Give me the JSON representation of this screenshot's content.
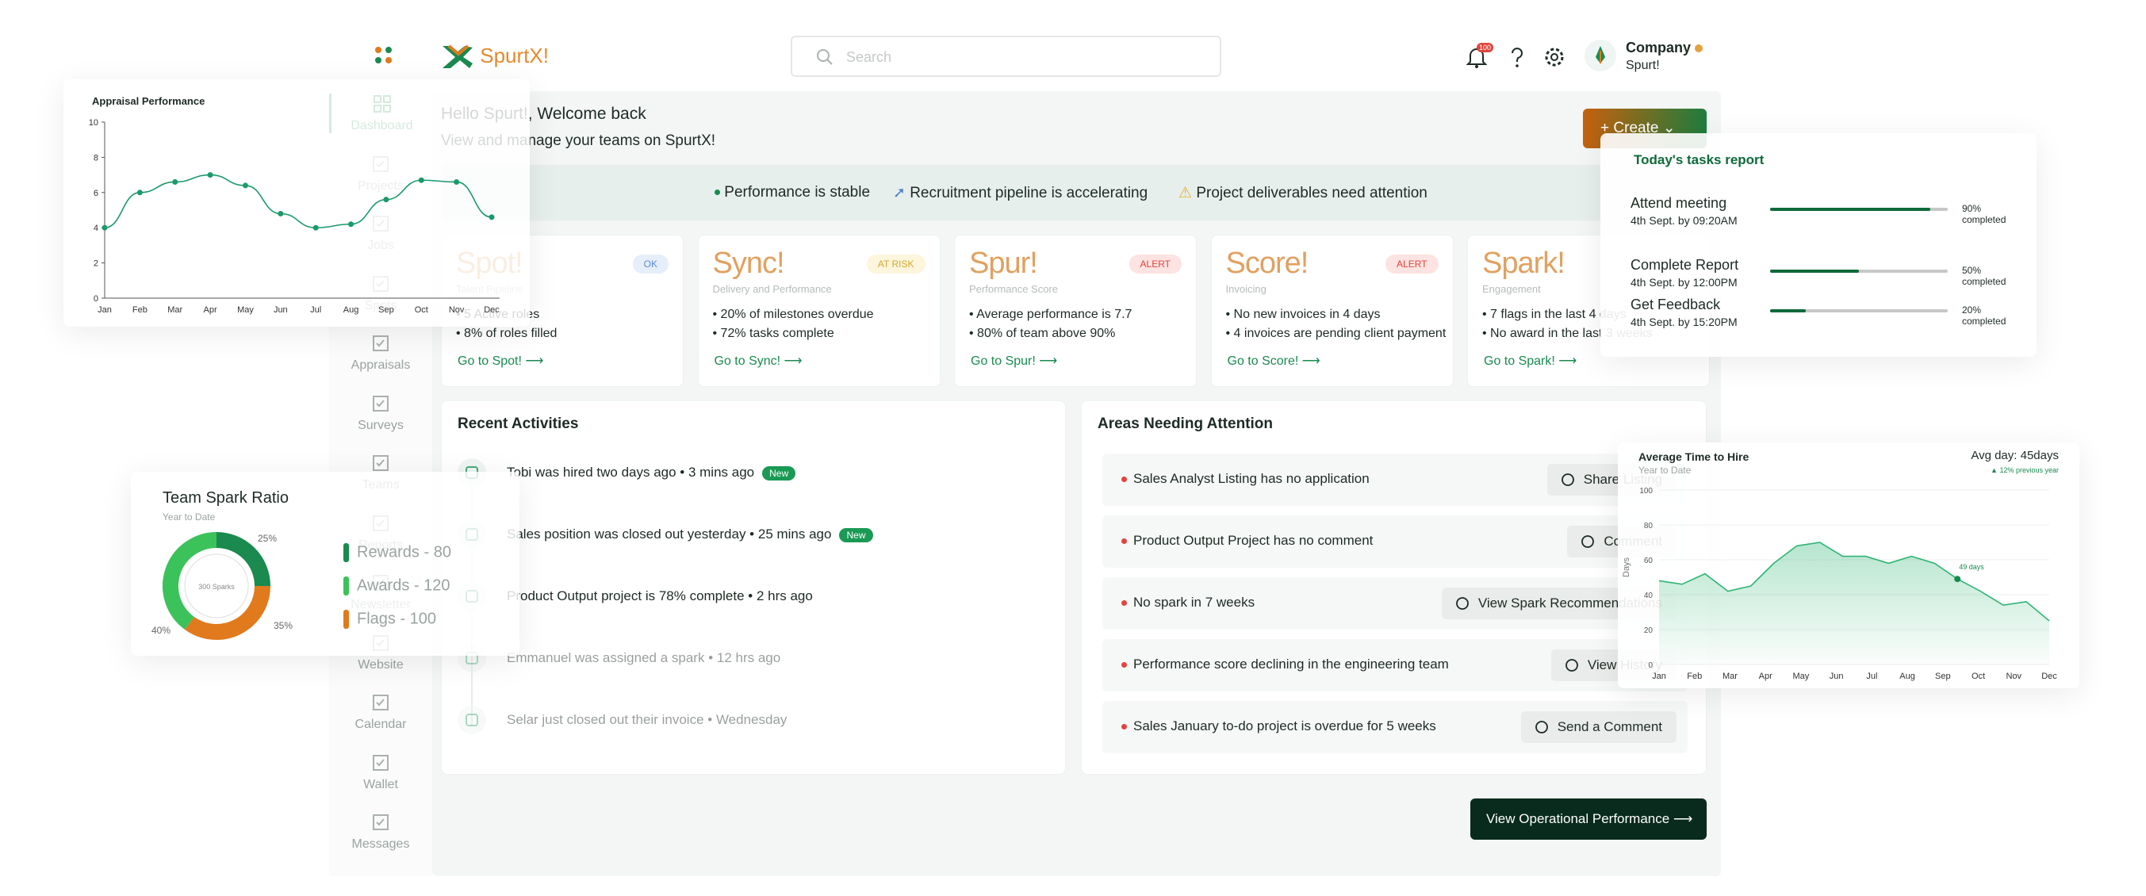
{
  "brand": {
    "logo_text": "SpurtX!"
  },
  "search": {
    "placeholder": "Search"
  },
  "header": {
    "notification_count": "100",
    "company_name": "Company",
    "company_sub": "Spurt!"
  },
  "sidebar": {
    "items": [
      {
        "label": "Dashboard",
        "icon": "dashboard-icon",
        "active": true
      },
      {
        "label": "Projects",
        "icon": "projects-icon"
      },
      {
        "label": "Jobs",
        "icon": "jobs-icon"
      },
      {
        "label": "Spots",
        "icon": "spots-icon"
      },
      {
        "label": "Appraisals",
        "icon": "appraisals-icon"
      },
      {
        "label": "Surveys",
        "icon": "surveys-icon"
      },
      {
        "label": "Teams",
        "icon": "teams-icon"
      },
      {
        "label": "Reports",
        "icon": "reports-icon"
      },
      {
        "label": "Newsletter",
        "icon": "newsletter-icon"
      },
      {
        "label": "Website",
        "icon": "website-icon"
      },
      {
        "label": "Calendar",
        "icon": "calendar-icon"
      },
      {
        "label": "Wallet",
        "icon": "wallet-icon"
      },
      {
        "label": "Messages",
        "icon": "messages-icon"
      }
    ]
  },
  "welcome": {
    "title": "Hello Spurt!, Welcome back",
    "subtitle": "View and manage your teams on SpurtX!",
    "create_label": "Create"
  },
  "banner": {
    "items": [
      "Performance is stable",
      "Recruitment pipeline is accelerating",
      "Project deliverables need attention"
    ]
  },
  "modules": [
    {
      "name": "Spot!",
      "sub": "Talent Pipeline",
      "badge": "OK",
      "badge_color": "#e6eef9",
      "badge_text": "#5b8bd6",
      "points": [
        "5 Active roles",
        "8% of roles filled"
      ],
      "link": "Go to Spot!"
    },
    {
      "name": "Sync!",
      "sub": "Delivery and Performance",
      "badge": "AT RISK",
      "badge_color": "#fdf6dc",
      "badge_text": "#d4a72c",
      "points": [
        "20% of milestones overdue",
        "72% tasks complete"
      ],
      "link": "Go to Sync!"
    },
    {
      "name": "Spur!",
      "sub": "Performance Score",
      "badge": "ALERT",
      "badge_color": "#fde3e1",
      "badge_text": "#e0453c",
      "points": [
        "Average performance is 7.7",
        "80% of team above 90%"
      ],
      "link": "Go to Spur!"
    },
    {
      "name": "Score!",
      "sub": "Invoicing",
      "badge": "ALERT",
      "badge_color": "#fde3e1",
      "badge_text": "#e0453c",
      "points": [
        "No new invoices in 4 days",
        "4 invoices are pending client payment"
      ],
      "link": "Go to Score!"
    },
    {
      "name": "Spark!",
      "sub": "Engagement",
      "badge": "",
      "badge_color": "",
      "badge_text": "",
      "points": [
        "7 flags in the last 4 days",
        "No award in the last 3 weeks"
      ],
      "link": "Go to Spark!"
    }
  ],
  "activities": {
    "title": "Recent Activities",
    "items": [
      {
        "text": "Tobi was hired two days ago",
        "time": "3 mins ago",
        "new": "New"
      },
      {
        "text": "Sales position was closed out yesterday",
        "time": "25 mins ago",
        "new": "New"
      },
      {
        "text": "Product Output project is 78% complete",
        "time": "2 hrs ago",
        "new": ""
      },
      {
        "text": "Emmanuel was assigned a spark",
        "time": "12 hrs ago",
        "new": ""
      },
      {
        "text": "Selar just closed out their invoice",
        "time": "Wednesday",
        "new": ""
      }
    ]
  },
  "attention": {
    "title": "Areas Needing Attention",
    "items": [
      {
        "text": "Sales Analyst Listing has no application",
        "action": "Share Listing",
        "icon": "share-icon"
      },
      {
        "text": "Product Output Project has no comment",
        "action": "Comment",
        "icon": "comment-icon"
      },
      {
        "text": "No spark in 7 weeks",
        "action": "View Spark Recommendations",
        "icon": "eye-icon"
      },
      {
        "text": "Performance score declining in the engineering team",
        "action": "View History",
        "icon": "history-icon"
      },
      {
        "text": "Sales January to-do project is overdue for 5 weeks",
        "action": "Send a Comment",
        "icon": "send-icon"
      }
    ]
  },
  "view_operational": "View Operational Performance",
  "tasks_report": {
    "title": "Today's tasks report",
    "items": [
      {
        "name": "Attend meeting",
        "date": "4th Sept. by 09:20AM",
        "progress": 0.9,
        "label": "90% completed"
      },
      {
        "name": "Complete Report",
        "date": "4th Sept. by 12:00PM",
        "progress": 0.5,
        "label": "50% completed"
      },
      {
        "name": "Get Feedback",
        "date": "4th Sept. by 15:20PM",
        "progress": 0.2,
        "label": "20% completed"
      }
    ]
  },
  "spark_ratio": {
    "title": "Team Spark Ratio",
    "subtitle": "Year to Date",
    "center": "300 Sparks",
    "legend": [
      "Rewards - 80",
      "Awards - 120",
      "Flags - 100"
    ],
    "legend_colors": [
      "#1a8a4f",
      "#3cc25a",
      "#e07a1c"
    ]
  },
  "chart_data": [
    {
      "type": "line",
      "title": "Appraisal Performance",
      "categories": [
        "Jan",
        "Feb",
        "Mar",
        "Apr",
        "May",
        "Jun",
        "Jul",
        "Aug",
        "Sep",
        "Oct",
        "Nov",
        "Dec"
      ],
      "values": [
        4,
        6,
        6.6,
        7,
        6.4,
        4.8,
        4,
        4.2,
        5.6,
        6.7,
        6.6,
        4.6
      ],
      "ylim": [
        0,
        10
      ],
      "yticks": [
        "0",
        "2",
        "4",
        "6",
        "8",
        "10"
      ]
    },
    {
      "type": "pie",
      "title": "Team Spark Ratio",
      "slices": [
        {
          "label": "25%",
          "value": 25,
          "color": "#1a8a4f"
        },
        {
          "label": "35%",
          "value": 35,
          "color": "#e07a1c"
        },
        {
          "label": "40%",
          "value": 40,
          "color": "#3cc25a"
        }
      ]
    },
    {
      "type": "area",
      "title": "Average Time to Hire",
      "subtitle": "Year to Date",
      "avg_label": "Avg day:",
      "avg_value": "45days",
      "trend": "▲ 12% previous year",
      "ylabel": "Days",
      "categories": [
        "Jan",
        "Feb",
        "Mar",
        "Apr",
        "May",
        "Jun",
        "Jul",
        "Aug",
        "Sep",
        "Oct",
        "Nov",
        "Dec"
      ],
      "x_positions": [
        0,
        0.5,
        1,
        1.5,
        2,
        2.5,
        3,
        3.5,
        4,
        4.5,
        5,
        5.5,
        6,
        6.5,
        7,
        7.5,
        8,
        8.5,
        9,
        9.5,
        10,
        10.5,
        11
      ],
      "values": [
        48,
        46,
        52,
        42,
        45,
        58,
        68,
        70,
        62,
        62,
        58,
        62,
        58,
        49,
        42,
        34,
        36,
        25
      ],
      "ylim": [
        0,
        100
      ],
      "yticks": [
        "0",
        "20",
        "40",
        "60",
        "80",
        "100"
      ],
      "marker_label": "49 days"
    }
  ]
}
